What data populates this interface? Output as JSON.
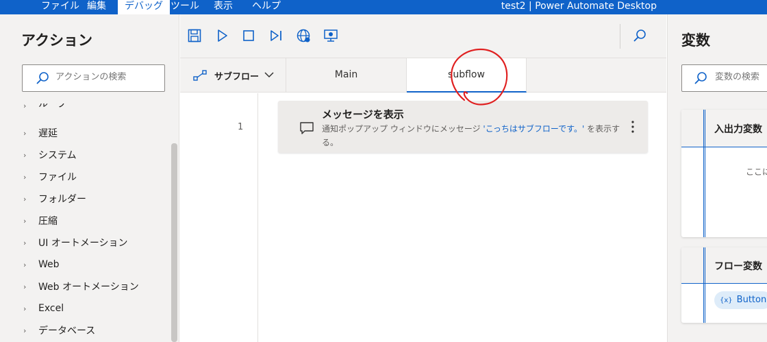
{
  "menubar": {
    "items": [
      "ファイル",
      "編集",
      "デバッグ",
      "ツール",
      "表示",
      "ヘルプ"
    ],
    "active_index": 2,
    "window_title": "test2 | Power Automate Desktop"
  },
  "actions_panel": {
    "title": "アクション",
    "search_placeholder": "アクションの検索",
    "items": [
      "ループ",
      "遅延",
      "システム",
      "ファイル",
      "フォルダー",
      "圧縮",
      "UI オートメーション",
      "Web",
      "Web オートメーション",
      "Excel",
      "データベース"
    ]
  },
  "toolbar": {
    "icons": [
      "save-icon",
      "run-icon",
      "stop-icon",
      "step-icon",
      "web-recorder-icon",
      "desktop-recorder-icon",
      "search-icon"
    ]
  },
  "tabs": {
    "subflow_dropdown_label": "サブフロー",
    "items": [
      "Main",
      "subflow"
    ],
    "active": "subflow"
  },
  "canvas": {
    "steps": [
      {
        "line": "1",
        "title": "メッセージを表示",
        "desc_prefix": "通知ポップアップ ウィンドウにメッセージ ",
        "desc_highlight": "'こっちはサブフローです。'",
        "desc_suffix": " を表示する。"
      }
    ]
  },
  "variables_panel": {
    "title": "変数",
    "search_placeholder": "変数の検索",
    "io_section_title": "入出力変数",
    "io_empty_hint": "ここに",
    "flow_section_title": "フロー変数",
    "flow_variables": [
      "Button"
    ],
    "chip_prefix": "{x}"
  },
  "colors": {
    "accent": "#0f62c9",
    "annotation": "#e02020",
    "panel_bg": "#f3f2f1"
  }
}
